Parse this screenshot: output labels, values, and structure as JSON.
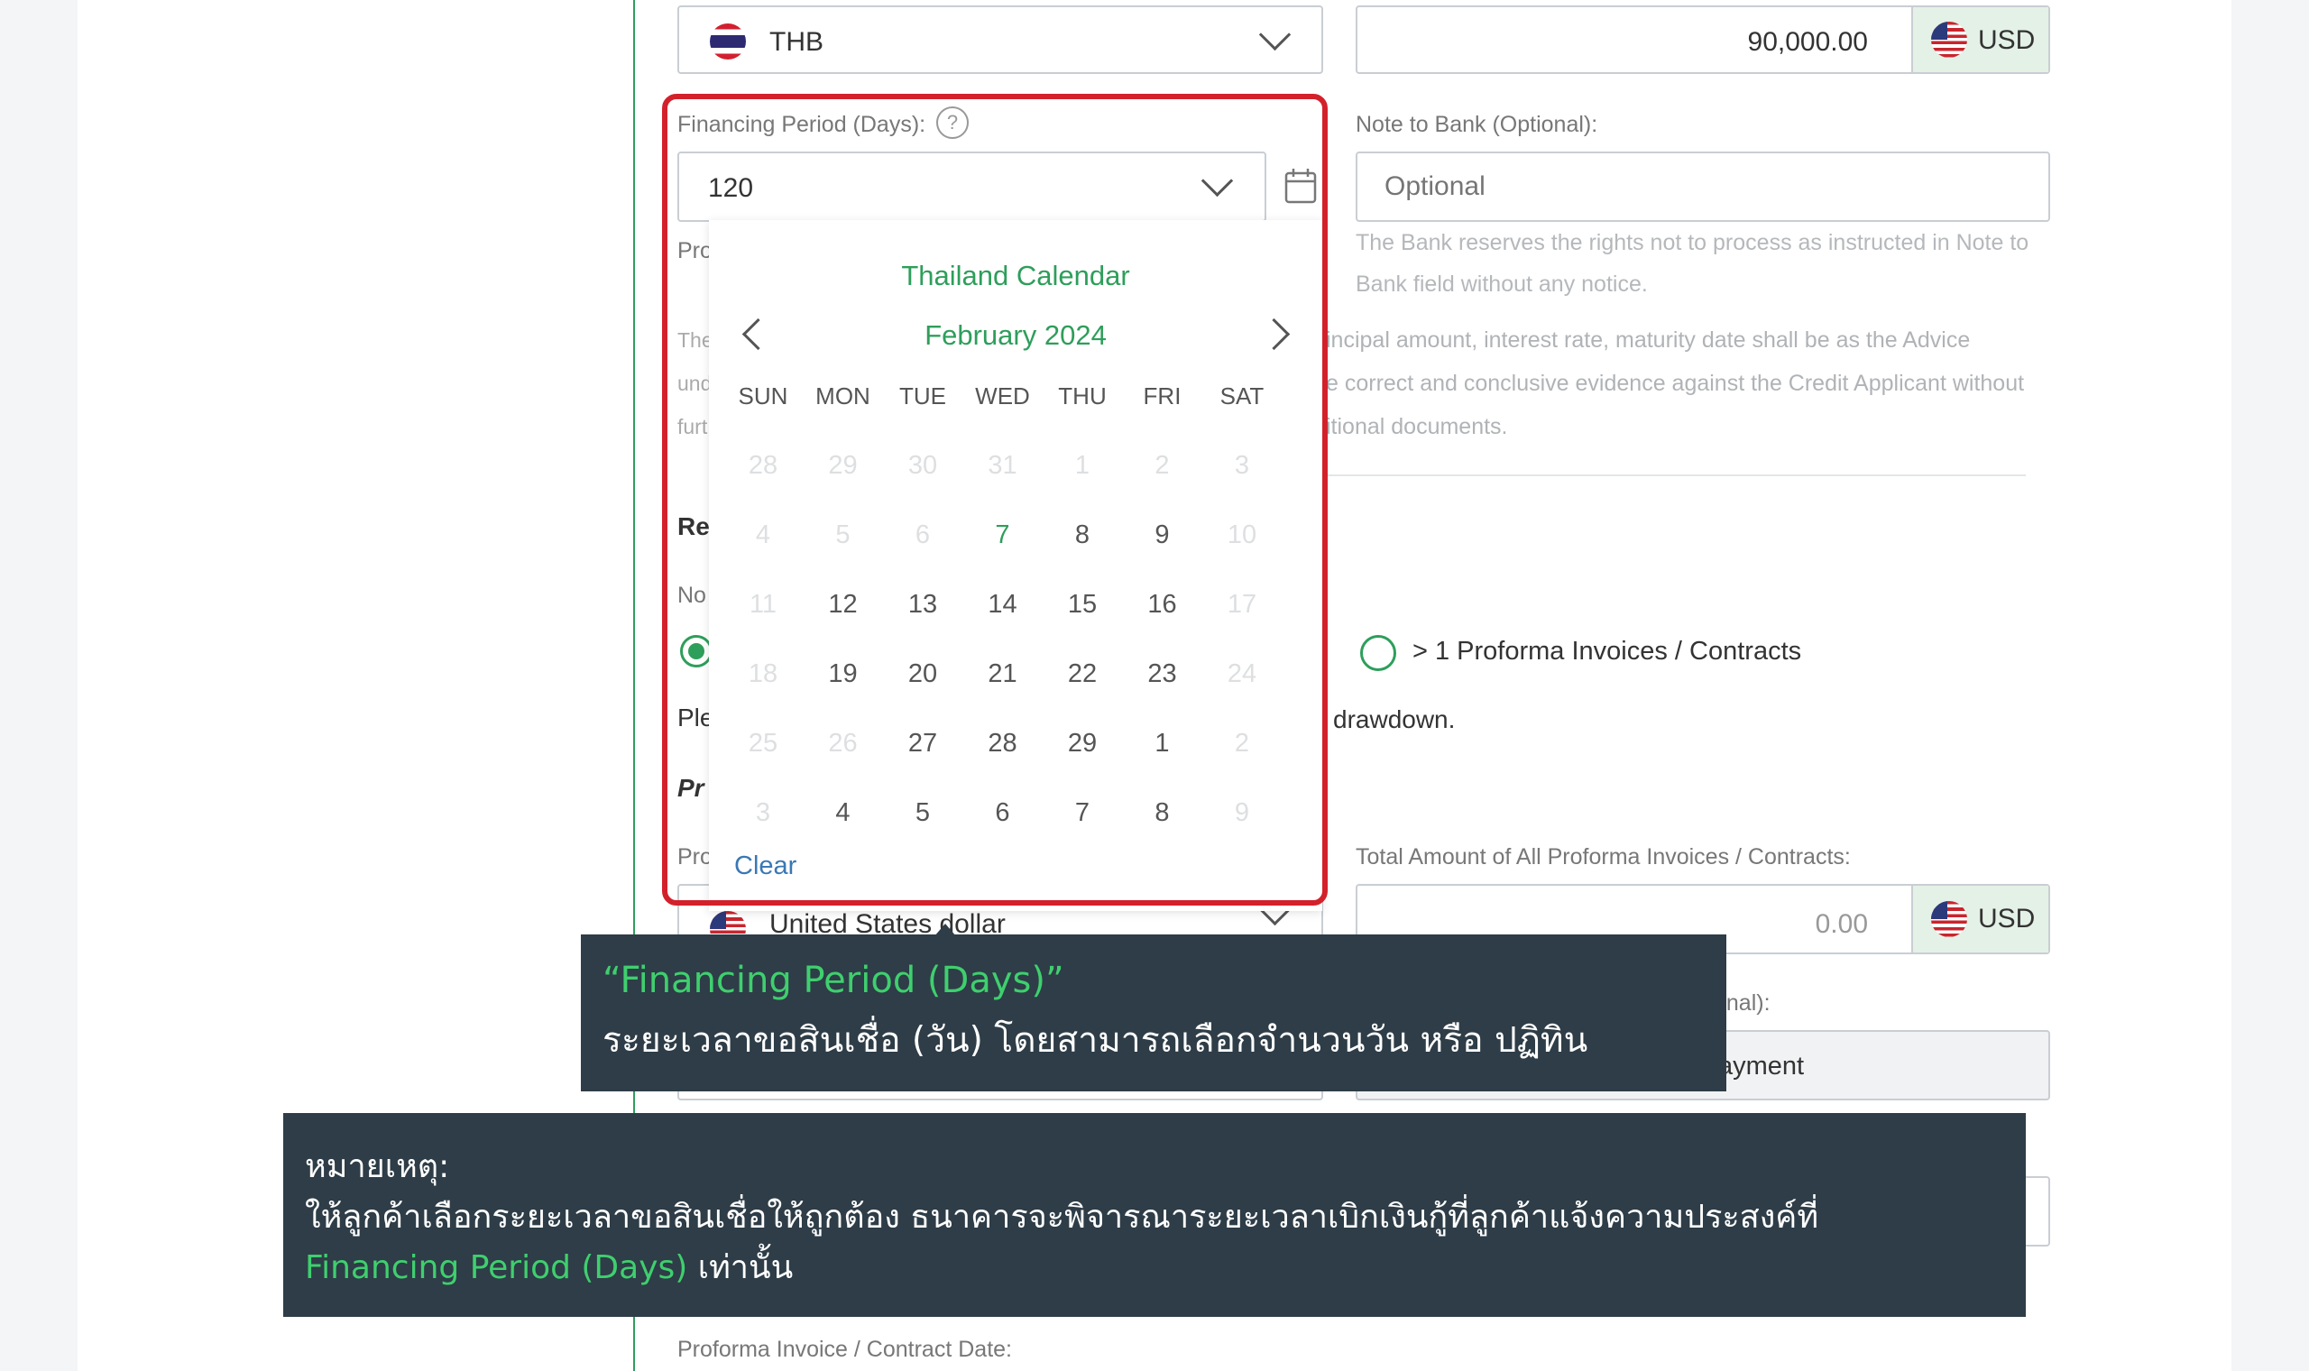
{
  "top_row": {
    "currency_select": {
      "code": "THB"
    },
    "amount_input": {
      "value": "90,000.00",
      "currency": "USD"
    }
  },
  "financing_period": {
    "label": "Financing Period (Days):",
    "help_icon": "?",
    "value": "120",
    "below_labels": [
      "Pro",
      "The",
      "und",
      "furt",
      "Re",
      "No",
      "Ple",
      "Pr",
      "Pro"
    ]
  },
  "note_to_bank": {
    "label": "Note to Bank (Optional):",
    "placeholder": "Optional",
    "help_text": "The Bank reserves the rights not to process as instructed in Note to Bank field without any notice."
  },
  "disclaimer": {
    "line1": "incipal amount, interest rate, maturity date shall be as the Advice",
    "line2": "e correct and conclusive evidence against the Credit Applicant without",
    "line3": "itional documents."
  },
  "invoices": {
    "radio_more_label": "> 1 Proforma Invoices / Contracts",
    "drawdown_fragment": "drawdown.",
    "currency_select_value": "United States dollar",
    "total_label": "Total Amount of All Proforma Invoices / Contracts:",
    "total_value": "0.00",
    "total_currency": "USD",
    "optional_label_fragment": "onal):",
    "repayment_fragment": "ayment",
    "date_label": "Proforma Invoice / Contract Date:"
  },
  "calendar": {
    "title": "Thailand Calendar",
    "month": "February 2024",
    "weekdays": [
      "SUN",
      "MON",
      "TUE",
      "WED",
      "THU",
      "FRI",
      "SAT"
    ],
    "weeks": [
      [
        {
          "d": "28",
          "off": true
        },
        {
          "d": "29",
          "off": true
        },
        {
          "d": "30",
          "off": true
        },
        {
          "d": "31",
          "off": true
        },
        {
          "d": "1",
          "off": true
        },
        {
          "d": "2",
          "off": true
        },
        {
          "d": "3",
          "off": true
        }
      ],
      [
        {
          "d": "4",
          "off": true
        },
        {
          "d": "5",
          "off": true
        },
        {
          "d": "6",
          "off": true
        },
        {
          "d": "7",
          "today": true
        },
        {
          "d": "8"
        },
        {
          "d": "9"
        },
        {
          "d": "10",
          "off": true
        }
      ],
      [
        {
          "d": "11",
          "off": true
        },
        {
          "d": "12"
        },
        {
          "d": "13"
        },
        {
          "d": "14"
        },
        {
          "d": "15"
        },
        {
          "d": "16"
        },
        {
          "d": "17",
          "off": true
        }
      ],
      [
        {
          "d": "18",
          "off": true
        },
        {
          "d": "19"
        },
        {
          "d": "20"
        },
        {
          "d": "21"
        },
        {
          "d": "22"
        },
        {
          "d": "23"
        },
        {
          "d": "24",
          "off": true
        }
      ],
      [
        {
          "d": "25",
          "off": true
        },
        {
          "d": "26",
          "off": true
        },
        {
          "d": "27"
        },
        {
          "d": "28"
        },
        {
          "d": "29"
        },
        {
          "d": "1"
        },
        {
          "d": "2",
          "off": true
        }
      ],
      [
        {
          "d": "3",
          "off": true
        },
        {
          "d": "4"
        },
        {
          "d": "5"
        },
        {
          "d": "6"
        },
        {
          "d": "7"
        },
        {
          "d": "8"
        },
        {
          "d": "9",
          "off": true
        }
      ]
    ],
    "clear_label": "Clear"
  },
  "callout_top": {
    "title": "“Financing Period (Days)”",
    "body": "ระยะเวลาขอสินเชื่อ (วัน) โดยสามารถเลือกจำนวนวัน หรือ ปฏิทิน"
  },
  "callout_note": {
    "heading": "หมายเหตุ:",
    "line1": "ให้ลูกค้าเลือกระยะเวลาขอสินเชื่อให้ถูกต้อง ธนาคารจะพิจารณาระยะเวลาเบิกเงินกู้ที่ลูกค้าแจ้งความประสงค์ที่",
    "highlight": "Financing Period (Days)",
    "line2_suffix": " เท่านั้น"
  },
  "colors": {
    "accent_green": "#2e9e5b",
    "highlight_red": "#d3212c",
    "callout_bg": "#2e3d47",
    "callout_green": "#3fcf6e"
  }
}
